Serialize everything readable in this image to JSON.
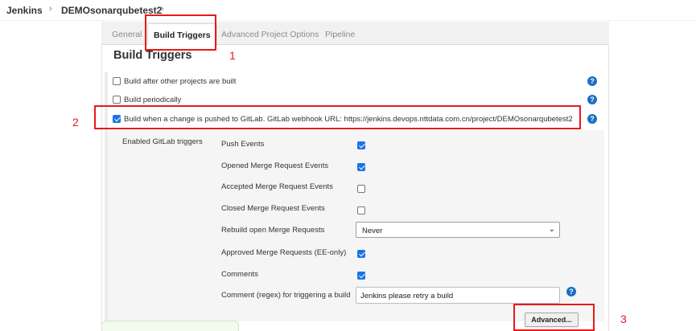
{
  "breadcrumb": {
    "items": [
      "Jenkins",
      "DEMOsonarqubetest2"
    ],
    "separator": "›"
  },
  "tabs": [
    {
      "label": "General",
      "active": false
    },
    {
      "label": "Build Triggers",
      "active": true
    },
    {
      "label": "Advanced Project Options",
      "active": false
    },
    {
      "label": "Pipeline",
      "active": false
    }
  ],
  "section": {
    "title": "Build Triggers"
  },
  "triggers": [
    {
      "label": "Build after other projects are built",
      "checked": false
    },
    {
      "label": "Build periodically",
      "checked": false
    },
    {
      "label": "Build when a change is pushed to GitLab. GitLab webhook URL: https://jenkins.devops.nttdata.com.cn/project/DEMOsonarqubetest2",
      "checked": true
    }
  ],
  "help_glyph": "?",
  "gitlab": {
    "group_label": "Enabled GitLab triggers",
    "options": [
      {
        "label": "Push Events",
        "checked": true
      },
      {
        "label": "Opened Merge Request Events",
        "checked": true
      },
      {
        "label": "Accepted Merge Request Events",
        "checked": false
      },
      {
        "label": "Closed Merge Request Events",
        "checked": false
      },
      {
        "label": "Approved Merge Requests (EE-only)",
        "checked": true
      },
      {
        "label": "Comments",
        "checked": true
      }
    ],
    "rebuild": {
      "label": "Rebuild open Merge Requests",
      "value": "Never"
    },
    "comment_regex": {
      "label": "Comment (regex) for triggering a build",
      "value": "Jenkins please retry a build"
    },
    "advanced_button": "Advanced..."
  },
  "annotations": [
    "1",
    "2",
    "3"
  ],
  "colors": {
    "annotation": "#e8191c",
    "checkbox": "#1a73e8",
    "help": "#1a6fc4"
  },
  "icons": {
    "help": "help-icon",
    "dropdown": "chevron-down-icon",
    "checkbox": "checkbox-icon"
  }
}
